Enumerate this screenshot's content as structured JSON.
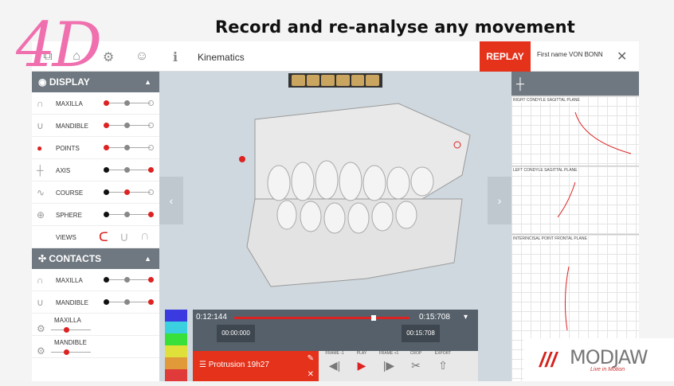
{
  "slide": {
    "title": "Record and re-analyse any movement",
    "badge": "4D"
  },
  "header": {
    "module": "Kinematics",
    "replay_label": "REPLAY",
    "user_name": "First name VON BONN"
  },
  "display": {
    "title": "DISPLAY",
    "items": [
      {
        "label": "MAXILLA",
        "icon": "maxilla-icon"
      },
      {
        "label": "MANDIBLE",
        "icon": "mandible-icon"
      },
      {
        "label": "POINTS",
        "icon": "points-icon"
      },
      {
        "label": "AXIS",
        "icon": "axis-icon"
      },
      {
        "label": "COURSE",
        "icon": "course-icon"
      },
      {
        "label": "SPHERE",
        "icon": "sphere-icon"
      },
      {
        "label": "VIEWS",
        "icon": "views-icon"
      }
    ]
  },
  "contacts": {
    "title": "CONTACTS",
    "items": [
      {
        "label": "MAXILLA"
      },
      {
        "label": "MANDIBLE"
      },
      {
        "label": "MAXILLA"
      },
      {
        "label": "MANDIBLE"
      }
    ]
  },
  "planes": [
    {
      "label": "RIGHT CONDYLE SAGITTAL PLANE"
    },
    {
      "label": "LEFT CONDYLE SAGITTAL PLANE"
    },
    {
      "label": "INTERINCISAL POINT FRONTAL PLANE"
    }
  ],
  "timeline": {
    "start": "0:12:144",
    "end": "0:15:708",
    "in": "00:00:000",
    "out": "00:15:708",
    "progress": 0.85
  },
  "controls": {
    "recording": "Protrusion 19h27",
    "buttons": [
      {
        "label": "FRAME -1"
      },
      {
        "label": "PLAY"
      },
      {
        "label": "FRAME +1"
      },
      {
        "label": "CROP"
      },
      {
        "label": "EXPORT"
      }
    ]
  },
  "branding": {
    "name": "MODJAW",
    "tagline": "Live in Motion"
  },
  "colors": {
    "accent": "#e4321b",
    "panel_header": "#6f7880",
    "badge": "#f06fae"
  }
}
